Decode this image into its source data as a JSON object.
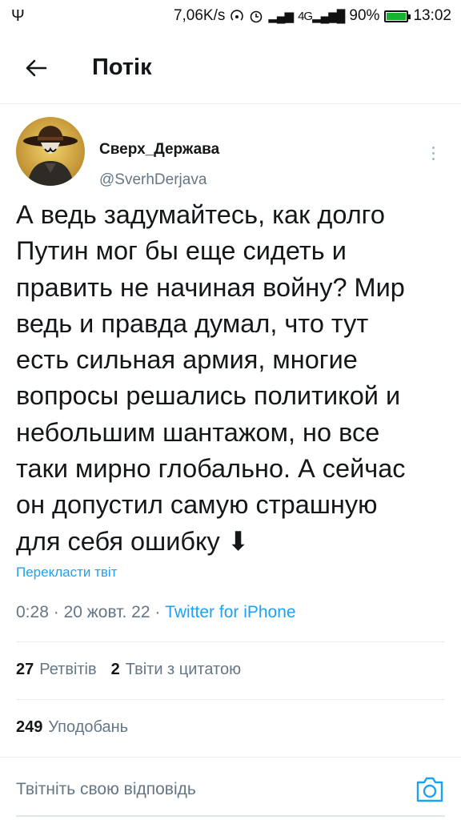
{
  "status_bar": {
    "left_icon": "usb-icon",
    "speed": "7,06K/s",
    "signal_text": "4G",
    "battery": "90%",
    "battery_level": 0.9,
    "time": "13:02"
  },
  "header": {
    "back_icon": "arrow-left-icon",
    "title": "Потік"
  },
  "tweet": {
    "author_name": "Сверх_Держава",
    "author_handle": "@SverhDerjava",
    "text": "А ведь задумайтесь, как долго\nПутин мог бы еще сидеть и\nправить не начиная войну? Мир\nведь и правда думал, что тут\nесть сильная армия, многие\nвопросы решались политикой и\nнебольшим шантажом, но все\nтаки мирно глобально. А сейчас\nон допустил самую страшную\nдля себя ошибку ⬇",
    "translate_label": "Перекласти твіт",
    "time": "0:28",
    "date": "20 жовт. 22",
    "separator": "·",
    "client": "Twitter for iPhone"
  },
  "stats": {
    "retweets_count": "27",
    "retweets_label": "Ретвітів",
    "quotes_count": "2",
    "quotes_label": "Твіти з цитатою",
    "likes_count": "249",
    "likes_label": "Уподобань"
  },
  "reply": {
    "placeholder": "Твітніть свою відповідь",
    "camera_icon": "camera-icon"
  },
  "colors": {
    "accent": "#1da1f2",
    "secondary_text": "#657786",
    "divider": "#e6ecf0",
    "battery_fill": "#16b32e"
  }
}
